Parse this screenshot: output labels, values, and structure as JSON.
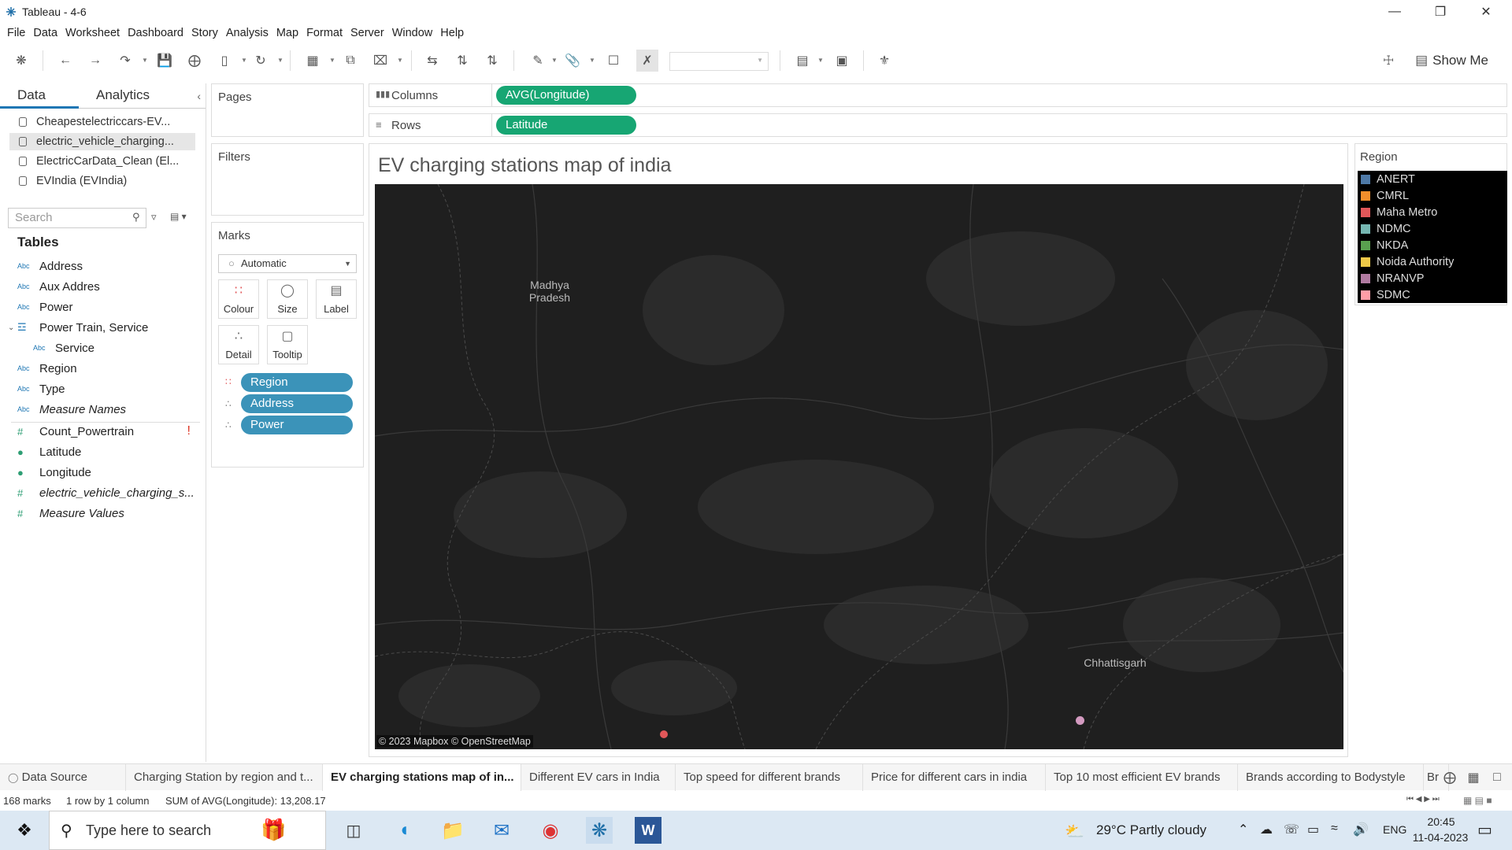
{
  "window": {
    "title": "Tableau - 4-6"
  },
  "menu": [
    "File",
    "Data",
    "Worksheet",
    "Dashboard",
    "Story",
    "Analysis",
    "Map",
    "Format",
    "Server",
    "Window",
    "Help"
  ],
  "toolbar": {
    "show_me": "Show Me"
  },
  "left_pane": {
    "tabs": [
      "Data",
      "Analytics"
    ],
    "data_sources": [
      "Cheapestelectriccars-EV...",
      "electric_vehicle_charging...",
      "ElectricCarData_Clean (El...",
      "EVIndia (EVIndia)"
    ],
    "selected_source_index": 1,
    "search_placeholder": "Search",
    "tables_heading": "Tables",
    "fields": [
      {
        "type": "Abc",
        "name": "Address"
      },
      {
        "type": "Abc",
        "name": "Aux Addres"
      },
      {
        "type": "Abc",
        "name": "Power"
      },
      {
        "type": "hier",
        "name": "Power Train, Service"
      },
      {
        "type": "Abc",
        "name": "Service"
      },
      {
        "type": "Abc",
        "name": "Region"
      },
      {
        "type": "Abc",
        "name": "Type"
      },
      {
        "type": "Abc",
        "name": "Measure Names"
      },
      {
        "type": "#",
        "name": "Count_Powertrain"
      },
      {
        "type": "globe",
        "name": "Latitude"
      },
      {
        "type": "globe",
        "name": "Longitude"
      },
      {
        "type": "#",
        "name": "electric_vehicle_charging_s..."
      },
      {
        "type": "#",
        "name": "Measure Values"
      }
    ]
  },
  "shelves": {
    "pages": "Pages",
    "filters": "Filters",
    "marks": "Marks",
    "mark_type": "Automatic",
    "mark_buttons": [
      "Colour",
      "Size",
      "Label",
      "Detail",
      "Tooltip"
    ],
    "mark_pills": [
      "Region",
      "Address",
      "Power"
    ],
    "columns_label": "Columns",
    "columns_pill": "AVG(Longitude)",
    "rows_label": "Rows",
    "rows_pill": "Latitude"
  },
  "view": {
    "title": "EV charging stations map of india",
    "map_labels": [
      "Madhya Pradesh",
      "Chhattisgarh"
    ],
    "attribution": "© 2023 Mapbox © OpenStreetMap"
  },
  "legend": {
    "title": "Region",
    "items": [
      {
        "name": "ANERT",
        "color": "#4e79a7"
      },
      {
        "name": "CMRL",
        "color": "#f28e2b"
      },
      {
        "name": "Maha Metro",
        "color": "#e15759"
      },
      {
        "name": "NDMC",
        "color": "#76b7b2"
      },
      {
        "name": "NKDA",
        "color": "#59a14f"
      },
      {
        "name": "Noida Authority",
        "color": "#edc948"
      },
      {
        "name": "NRANVP",
        "color": "#b07aa1"
      },
      {
        "name": "SDMC",
        "color": "#ff9da7"
      }
    ]
  },
  "sheet_tabs": [
    "Data Source",
    "Charging Station by region and t...",
    "EV charging stations map of in...",
    "Different EV cars in India",
    "Top speed for different brands",
    "Price for different cars in india",
    "Top 10 most efficient EV brands",
    "Brands according to Bodystyle",
    "Br"
  ],
  "active_sheet_index": 2,
  "status": {
    "marks": "168 marks",
    "dims": "1 row by 1 column",
    "sum": "SUM of AVG(Longitude): 13,208.17"
  },
  "taskbar": {
    "search_placeholder": "Type here to search",
    "weather": "29°C  Partly cloudy",
    "lang": "ENG",
    "time": "20:45",
    "date": "11-04-2023"
  }
}
